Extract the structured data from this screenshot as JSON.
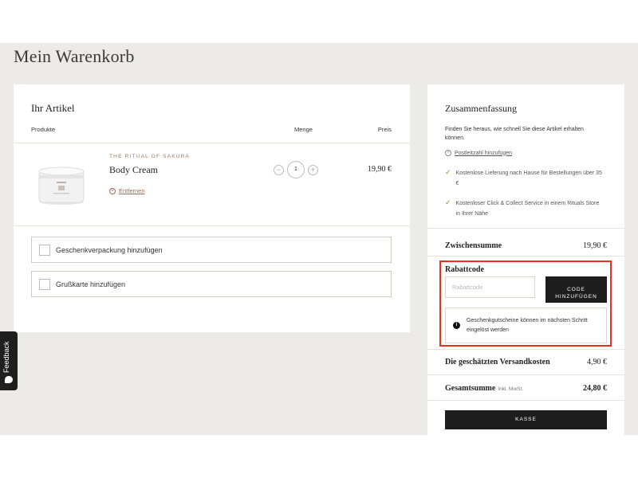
{
  "page": {
    "title": "Mein Warenkorb"
  },
  "articles": {
    "title": "Ihr Artikel",
    "columns": {
      "products": "Produkte",
      "quantity": "Menge",
      "price": "Preis"
    },
    "items": [
      {
        "brand": "THE RITUAL OF SAKURA",
        "name": "Body Cream",
        "remove_label": "Entfernen",
        "quantity": "1",
        "price": "19,90 €"
      }
    ],
    "options": {
      "gift_wrap": "Geschenkverpackung hinzufügen",
      "greeting_card": "Grußkarte hinzufügen"
    }
  },
  "summary": {
    "title": "Zusammenfassung",
    "delivery_info": "Finden Sie heraus, wie schnell Sie diese Artikel erhalten können.",
    "postcode_link": "Postleitzahl hinzufügen",
    "benefits": [
      "Kostenlose Lieferung nach Hause für Bestellungen über 35 €",
      "Kostenloser Click & Collect Service in einem Rituals Store in Ihrer Nähe"
    ],
    "subtotal_label": "Zwischensumme",
    "subtotal_value": "19,90 €",
    "discount": {
      "label": "Rabattcode",
      "placeholder": "Rabattcode",
      "button_label": "CODE HINZUFÜGEN",
      "notice": "Geschenkgutscheine können im nächsten Schritt eingelöst werden"
    },
    "shipping_label": "Die geschätzten Versandkosten",
    "shipping_value": "4,90 €",
    "total_label": "Gesamtsumme",
    "total_tax_note": "Inkl. MwSt.",
    "total_value": "24,80 €",
    "checkout_label": "KASSE"
  },
  "feedback": {
    "label": "Feedback"
  },
  "colors": {
    "background": "#edebe8",
    "accent_brand": "#9b7a5d",
    "button_dark": "#1d1d1d",
    "highlight_red": "#e8321e",
    "check_green": "#7a9a3a"
  }
}
